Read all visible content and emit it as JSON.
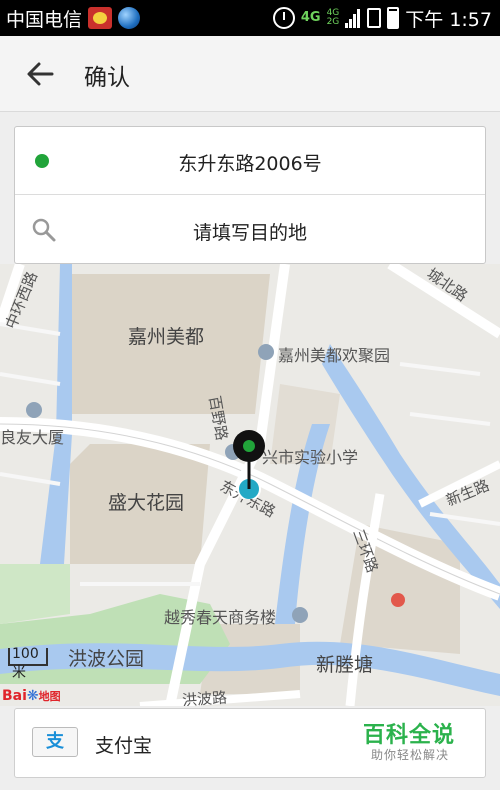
{
  "status_bar": {
    "carrier": "中国电信",
    "network": "4G",
    "network_sub_top": "4G",
    "network_sub_bottom": "2G",
    "time": "下午 1:57"
  },
  "app_bar": {
    "title": "确认",
    "back_icon": "arrow-left-icon"
  },
  "route": {
    "origin": "东升东路2006号",
    "destination_placeholder": "请填写目的地"
  },
  "map": {
    "labels": {
      "jiazhou_meidu": "嘉州美都",
      "jiazhou_huanju": "嘉州美都欢聚园",
      "xingshi_school": "兴市实验小学",
      "liangyou": "良友大厦",
      "shengda": "盛大花园",
      "yuexiu": "越秀春天商务楼",
      "hongbo_park": "洪波公园",
      "xinshengtang": "新塍塘",
      "scale": "100米",
      "baidu": "Bai",
      "baidu_map": "地图"
    },
    "roads": {
      "zhonghuan": "中环西路",
      "chengbei": "城北路",
      "baiye": "百野路",
      "dongsheng": "东升东路",
      "xinsheng": "新生路",
      "sanhuan": "三环路",
      "hongbo": "洪波路"
    },
    "colors": {
      "water": "#a9c9ef",
      "green": "#bfe0b6",
      "pin": "#111111",
      "pin_dot": "#21a43a",
      "location": "#23a9c5"
    }
  },
  "payment": {
    "method": "支付宝",
    "icon_glyph": "支"
  },
  "watermark": {
    "title": "百科全说",
    "subtitle": "助你轻松解决"
  }
}
